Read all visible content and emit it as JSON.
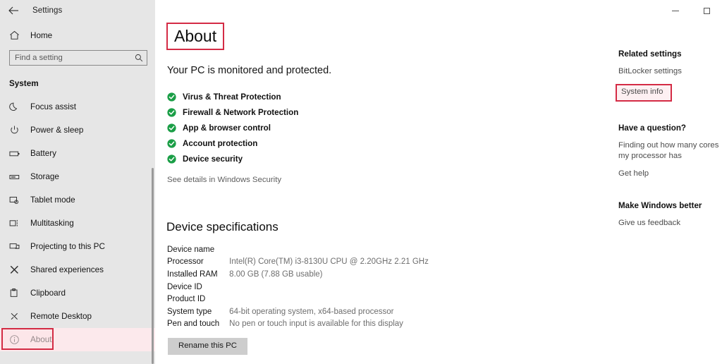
{
  "window": {
    "title": "Settings",
    "back_icon": "back-arrow-icon",
    "minimize_label": "Minimize",
    "maximize_label": "Maximize"
  },
  "sidebar": {
    "home": {
      "label": "Home",
      "icon": "home-icon"
    },
    "search": {
      "placeholder": "Find a setting",
      "value": "",
      "icon": "search-icon"
    },
    "section_title": "System",
    "items": [
      {
        "label": "Focus assist",
        "icon": "moon-icon",
        "selected": false
      },
      {
        "label": "Power & sleep",
        "icon": "power-icon",
        "selected": false
      },
      {
        "label": "Battery",
        "icon": "battery-icon",
        "selected": false
      },
      {
        "label": "Storage",
        "icon": "storage-icon",
        "selected": false
      },
      {
        "label": "Tablet mode",
        "icon": "tablet-icon",
        "selected": false
      },
      {
        "label": "Multitasking",
        "icon": "multitasking-icon",
        "selected": false
      },
      {
        "label": "Projecting to this PC",
        "icon": "projecting-icon",
        "selected": false
      },
      {
        "label": "Shared experiences",
        "icon": "shared-icon",
        "selected": false
      },
      {
        "label": "Clipboard",
        "icon": "clipboard-icon",
        "selected": false
      },
      {
        "label": "Remote Desktop",
        "icon": "remote-desktop-icon",
        "selected": false
      },
      {
        "label": "About",
        "icon": "info-icon",
        "selected": true
      }
    ]
  },
  "main": {
    "page_title": "About",
    "subtitle": "Your PC is monitored and protected.",
    "protection_items": [
      "Virus & Threat Protection",
      "Firewall & Network Protection",
      "App & browser control",
      "Account protection",
      "Device security"
    ],
    "see_details_link": "See details in Windows Security",
    "device_specs_title": "Device specifications",
    "device_specs": [
      {
        "key": "Device name",
        "value": ""
      },
      {
        "key": "Processor",
        "value": "Intel(R) Core(TM) i3-8130U CPU @ 2.20GHz   2.21 GHz"
      },
      {
        "key": "Installed RAM",
        "value": "8.00 GB (7.88 GB usable)"
      },
      {
        "key": "Device ID",
        "value": ""
      },
      {
        "key": "Product ID",
        "value": ""
      },
      {
        "key": "System type",
        "value": "64-bit operating system, x64-based processor"
      },
      {
        "key": "Pen and touch",
        "value": "No pen or touch input is available for this display"
      }
    ],
    "rename_button": "Rename this PC"
  },
  "rail": {
    "related_settings_title": "Related settings",
    "bitlocker_link": "BitLocker settings",
    "system_info_link": "System info",
    "question_title": "Have a question?",
    "cores_link": "Finding out how many cores my processor has",
    "help_link": "Get help",
    "make_better_title": "Make Windows better",
    "feedback_link": "Give us feedback"
  },
  "colors": {
    "highlight_red": "#d42b45",
    "check_green": "#1a9e46",
    "sidebar_bg": "#e6e6e6",
    "button_gray": "#cdcdcd"
  }
}
